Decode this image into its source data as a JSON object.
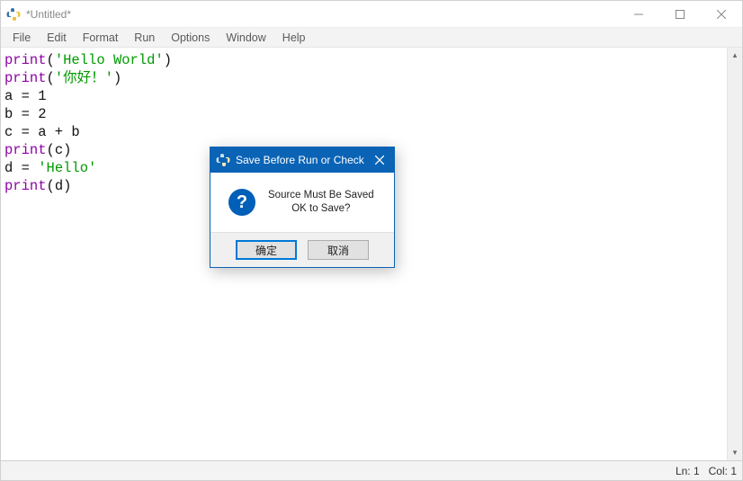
{
  "window": {
    "title": "*Untitled*"
  },
  "menu": {
    "items": [
      "File",
      "Edit",
      "Format",
      "Run",
      "Options",
      "Window",
      "Help"
    ]
  },
  "code": {
    "lines": [
      [
        {
          "cls": "tok-func",
          "t": "print"
        },
        {
          "cls": "tok-op",
          "t": "("
        },
        {
          "cls": "tok-str",
          "t": "'Hello World'"
        },
        {
          "cls": "tok-op",
          "t": ")"
        }
      ],
      [
        {
          "cls": "tok-func",
          "t": "print"
        },
        {
          "cls": "tok-op",
          "t": "("
        },
        {
          "cls": "tok-str",
          "t": "'你好！'"
        },
        {
          "cls": "tok-op",
          "t": ")"
        }
      ],
      [
        {
          "cls": "tok-name",
          "t": "a = 1"
        }
      ],
      [
        {
          "cls": "tok-name",
          "t": "b = 2"
        }
      ],
      [
        {
          "cls": "tok-name",
          "t": "c = a + b"
        }
      ],
      [
        {
          "cls": "tok-func",
          "t": "print"
        },
        {
          "cls": "tok-op",
          "t": "("
        },
        {
          "cls": "tok-name",
          "t": "c"
        },
        {
          "cls": "tok-op",
          "t": ")"
        }
      ],
      [
        {
          "cls": "tok-name",
          "t": "d = "
        },
        {
          "cls": "tok-str",
          "t": "'Hello'"
        }
      ],
      [
        {
          "cls": "tok-func",
          "t": "print"
        },
        {
          "cls": "tok-op",
          "t": "("
        },
        {
          "cls": "tok-name",
          "t": "d"
        },
        {
          "cls": "tok-op",
          "t": ")"
        }
      ]
    ]
  },
  "status": {
    "ln_label": "Ln: 1",
    "col_label": "Col: 1"
  },
  "dialog": {
    "title": "Save Before Run or Check",
    "line1": "Source Must Be Saved",
    "line2": "OK to Save?",
    "ok": "确定",
    "cancel": "取消"
  }
}
